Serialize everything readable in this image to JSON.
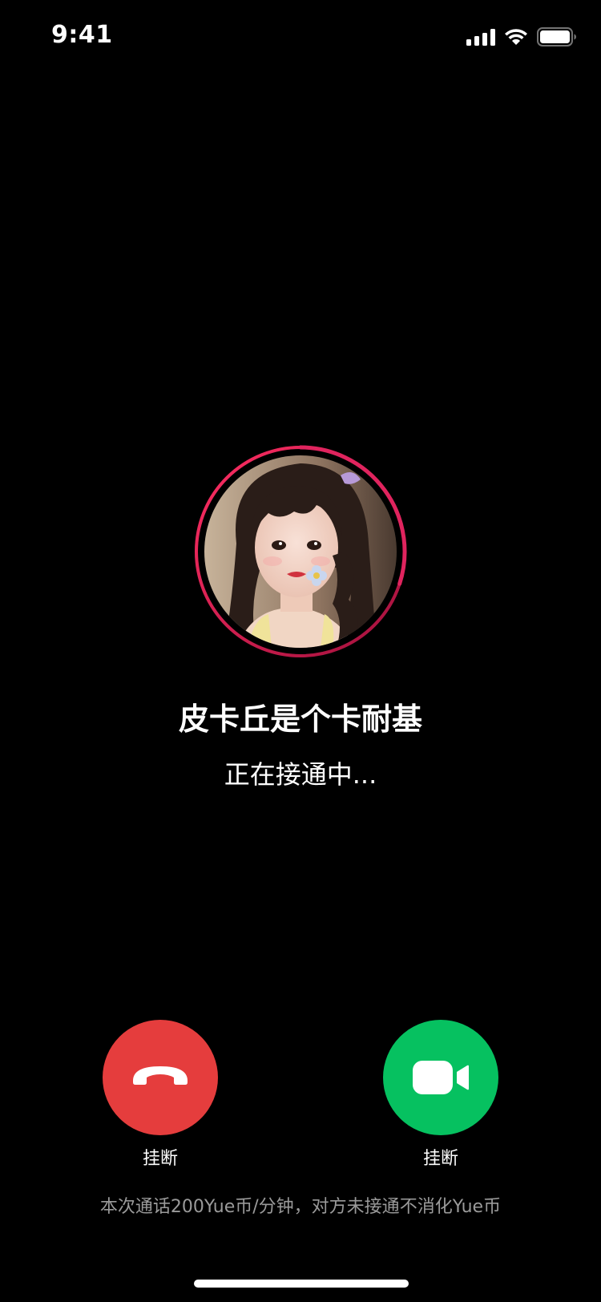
{
  "status_bar": {
    "time": "9:41"
  },
  "caller": {
    "name": "皮卡丘是个卡耐基",
    "status": "正在接通中...",
    "ring_color": "#e0245e",
    "ring_progress": 0.3
  },
  "actions": {
    "hangup": {
      "label": "挂断",
      "icon": "phone-hangup-icon",
      "color": "#e53d3d"
    },
    "video": {
      "label": "挂断",
      "icon": "video-camera-icon",
      "color": "#06c160"
    }
  },
  "billing_note": "本次通话200Yue币/分钟，对方未接通不消化Yue币"
}
